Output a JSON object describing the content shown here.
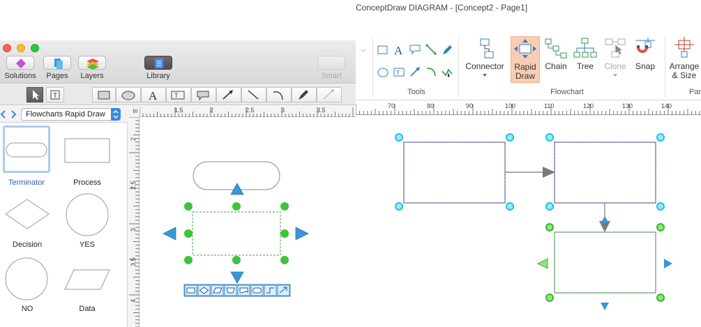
{
  "mac": {
    "toolbar": {
      "solutions": "Solutions",
      "pages": "Pages",
      "layers": "Layers",
      "library": "Library",
      "smart": "Smart"
    },
    "library_select": "Flowcharts Rapid Draw",
    "library_items": [
      {
        "label": "Terminator"
      },
      {
        "label": "Process"
      },
      {
        "label": "Decision"
      },
      {
        "label": "YES"
      },
      {
        "label": "NO"
      },
      {
        "label": "Data"
      }
    ],
    "ruler_h": [
      "1.5",
      "2",
      "2.5",
      "3",
      "3.5"
    ],
    "ruler_unit": "in",
    "ruler_v": [
      "2",
      "2.5",
      "3",
      "3.5",
      "4"
    ]
  },
  "win": {
    "title": "ConceptDraw DIAGRAM - [Concept2 - Page1]",
    "ribbon": {
      "tools_label": "Tools",
      "connector": "Connector",
      "rapid_draw_1": "Rapid",
      "rapid_draw_2": "Draw",
      "chain": "Chain",
      "tree": "Tree",
      "clone": "Clone",
      "snap": "Snap",
      "flowchart_label": "Flowchart",
      "arrange_1": "Arrange",
      "arrange_2": "& Size",
      "panel_partial": "Pan"
    },
    "ruler": [
      "70",
      "80",
      "90",
      "100",
      "110",
      "120",
      "130",
      "140"
    ]
  },
  "colors": {
    "handle_green": "#3fc43a",
    "arrow_blue": "#3a96d4",
    "handle_cyan": "#29c6e8",
    "selection_dash": "#2d9d3a",
    "active_ribbon": "#f9cdb4",
    "mac_active_tool": "#5b5b5b"
  }
}
